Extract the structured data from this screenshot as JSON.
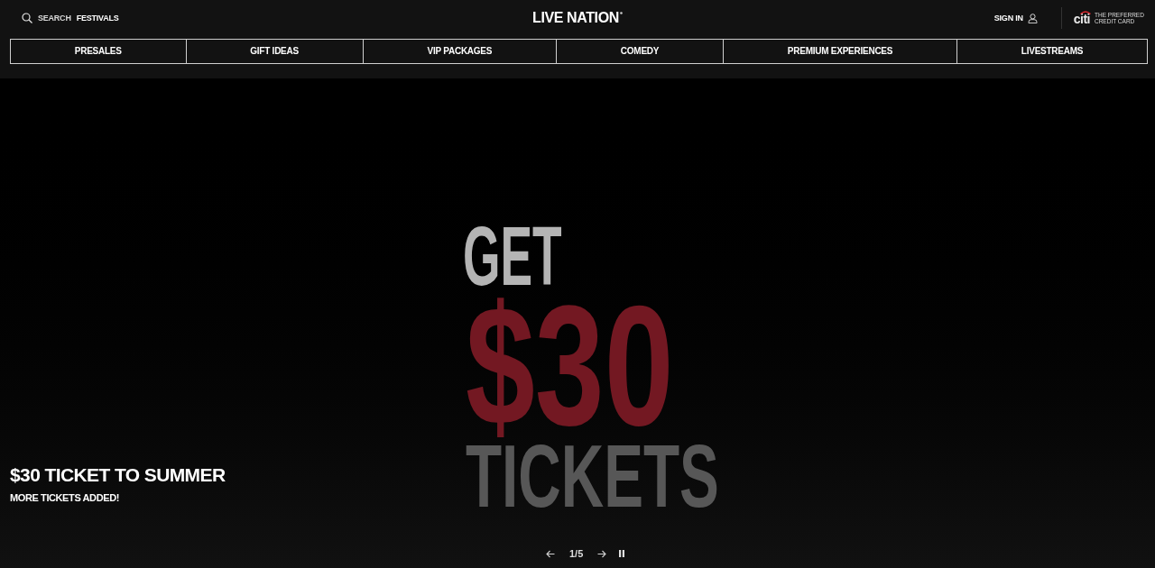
{
  "header": {
    "search": {
      "label": "SEARCH",
      "suggestion": "FESTIVALS"
    },
    "logo": "LIVE NATION",
    "sign_in": "SIGN IN",
    "sponsor": {
      "logo": "citi",
      "tagline": "THE PREFERRED CREDIT CARD"
    }
  },
  "nav": [
    "PRESALES",
    "GIFT IDEAS",
    "VIP PACKAGES",
    "COMEDY",
    "PREMIUM EXPERIENCES",
    "LIVESTREAMS"
  ],
  "hero": {
    "art": [
      {
        "text": "GET",
        "color": "#b4b4b4"
      },
      {
        "text": "$30",
        "color": "#731822"
      },
      {
        "text": "TICKETS",
        "color": "#575757"
      }
    ],
    "title": "$30 TICKET TO SUMMER",
    "subtitle": "MORE TICKETS ADDED!",
    "carousel": {
      "counter": "1/5",
      "playing": true
    }
  }
}
